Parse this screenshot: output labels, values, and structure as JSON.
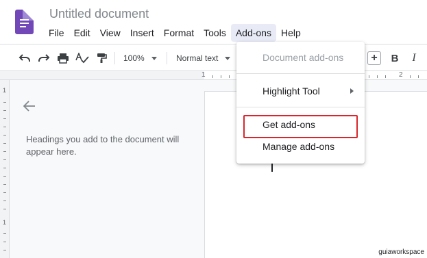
{
  "document": {
    "title": "Untitled document"
  },
  "menu": {
    "items": [
      {
        "label": "File"
      },
      {
        "label": "Edit"
      },
      {
        "label": "View"
      },
      {
        "label": "Insert"
      },
      {
        "label": "Format"
      },
      {
        "label": "Tools"
      },
      {
        "label": "Add-ons",
        "active": true
      },
      {
        "label": "Help"
      }
    ]
  },
  "toolbar": {
    "zoom": "100%",
    "paragraph_style": "Normal text",
    "increase_size": "+",
    "bold": "B",
    "italic": "I"
  },
  "ruler": {
    "marks": [
      "1",
      "2"
    ],
    "left_marks": [
      "1",
      "1"
    ]
  },
  "outline": {
    "empty_message": "Headings you add to the document will appear here."
  },
  "addons_menu": {
    "header": "Document add-ons",
    "items": [
      {
        "label": "Highlight Tool",
        "has_submenu": true
      },
      {
        "label": "Get add-ons",
        "highlighted": true
      },
      {
        "label": "Manage add-ons"
      }
    ],
    "highlight_color": "#d9252b"
  },
  "colors": {
    "docs_icon": "#7248b9",
    "active_menu_bg": "#e8eaf6"
  },
  "watermark": "guiaworkspace"
}
